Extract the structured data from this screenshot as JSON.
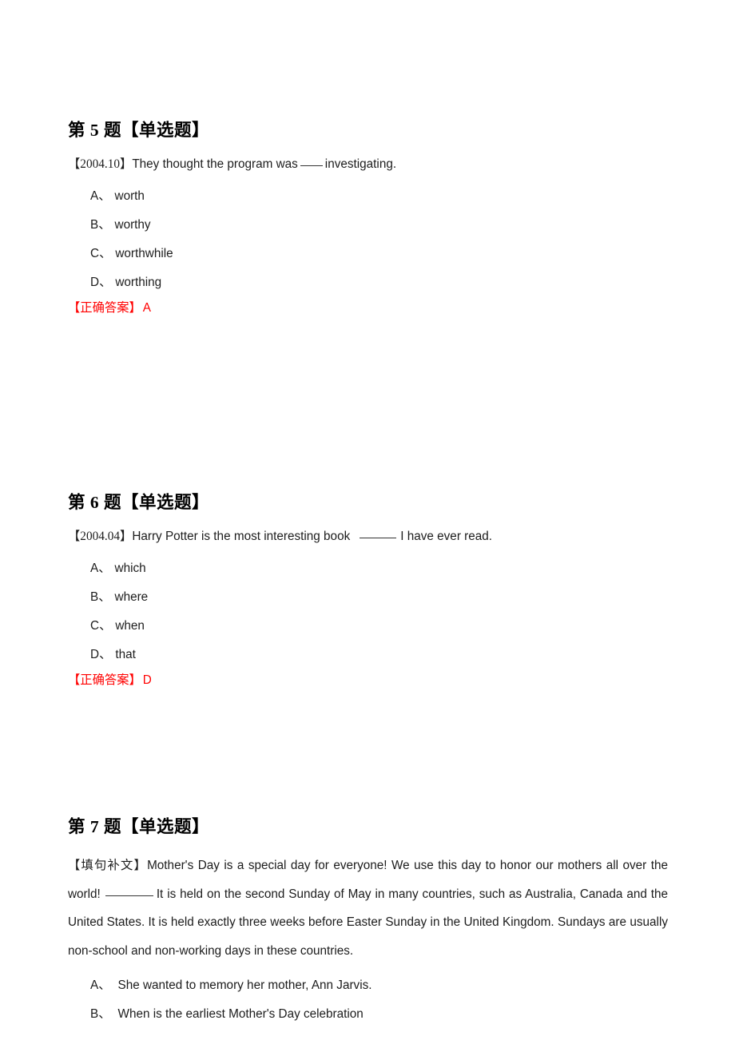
{
  "document": {
    "type": "exam-question-sheet",
    "accent_red": "#ff0000",
    "text_color": "#1c1c1c",
    "background": "#ffffff"
  },
  "questions": [
    {
      "heading_prefix": "第",
      "number": "5",
      "heading_suffix": "题【单选题】",
      "heading_full": "第 5 题【单选题】",
      "source_tag": "【2004.10】",
      "stem_before": "They thought the program was",
      "stem_after": "investigating.",
      "blank_style": "short",
      "options": [
        {
          "key": "A",
          "sep": "、",
          "text": "worth"
        },
        {
          "key": "B",
          "sep": "、",
          "text": "worthy"
        },
        {
          "key": "C",
          "sep": "、",
          "text": "worthwhile"
        },
        {
          "key": "D",
          "sep": "、",
          "text": "worthing"
        }
      ],
      "answer_label": "【正确答案】",
      "answer_value": "A"
    },
    {
      "heading_prefix": "第",
      "number": "6",
      "heading_suffix": "题【单选题】",
      "heading_full": "第 6 题【单选题】",
      "source_tag": "【2004.04】",
      "stem_before": "Harry Potter is the most interesting book",
      "stem_after": "I have ever read.",
      "blank_style": "mid",
      "options": [
        {
          "key": "A",
          "sep": "、",
          "text": "which"
        },
        {
          "key": "B",
          "sep": "、",
          "text": "where"
        },
        {
          "key": "C",
          "sep": "、",
          "text": "when"
        },
        {
          "key": "D",
          "sep": "、",
          "text": "that"
        }
      ],
      "answer_label": "【正确答案】",
      "answer_value": "D"
    },
    {
      "heading_prefix": "第",
      "number": "7",
      "heading_suffix": "题【单选题】",
      "heading_full": "第 7 题【单选题】",
      "source_tag": "【填句补文】",
      "passage_before": "Mother's Day is a special day for everyone! We use this day to honor our mothers all over the world!",
      "passage_after": "It is held on the second Sunday of May in many countries, such as Australia, Canada and the United States. It is held exactly three weeks before Easter Sunday in the United Kingdom. Sundays are usually non-school and non-working days in these countries.",
      "blank_style": "long",
      "options": [
        {
          "key": "A",
          "sep": "、",
          "text": "She wanted to memory her mother, Ann Jarvis."
        },
        {
          "key": "B",
          "sep": "、",
          "text": "When is the earliest Mother's Day celebration"
        }
      ],
      "answer_label": "",
      "answer_value": ""
    }
  ]
}
